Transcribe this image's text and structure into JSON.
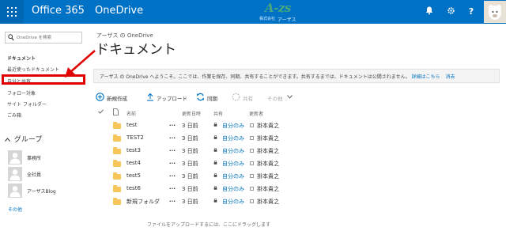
{
  "topbar": {
    "brand": "Office 365",
    "app_name": "OneDrive",
    "logo_text": "A-zs",
    "logo_sub": "アーザス",
    "logo_small": "株式会社",
    "icons": [
      "waffle-icon",
      "bell-icon",
      "gear-icon",
      "help-icon"
    ],
    "accent_color": "#0072c6"
  },
  "left_nav": {
    "search_placeholder": "OneDrive を検索",
    "heading": "ドキュメント",
    "items": [
      {
        "label": "最近使ったドキュメント"
      },
      {
        "label": "自分と共有"
      },
      {
        "label": "フォロー対象"
      },
      {
        "label": "サイト フォルダー"
      },
      {
        "label": "ごみ箱"
      }
    ],
    "groups_header": "グループ",
    "groups": [
      {
        "label": "事務所"
      },
      {
        "label": "全社員"
      },
      {
        "label": "アーザスBlog"
      }
    ],
    "more": "その他"
  },
  "main": {
    "breadcrumb": "アーザス の OneDrive",
    "title": "ドキュメント",
    "banner": {
      "message": "アーザス の OneDrive へようこそ。ここでは、作業を保存、同期、共有することができます。共有するまでは、ドキュメントは公開されません。",
      "link": "詳細はこちら",
      "dismiss": "消去"
    },
    "commands": {
      "new": "新規作成",
      "upload": "アップロード",
      "sync": "同期",
      "share": "共有",
      "more": "その他"
    },
    "columns": {
      "name": "名前",
      "modified": "更新日時",
      "shared": "共有",
      "modified_by": "更新者"
    },
    "files": [
      {
        "name": "test",
        "modified": "3 日前",
        "sharing": "自分のみ",
        "editor": "掛本貴之"
      },
      {
        "name": "TEST2",
        "modified": "3 日前",
        "sharing": "自分のみ",
        "editor": "掛本貴之"
      },
      {
        "name": "test3",
        "modified": "3 日前",
        "sharing": "自分のみ",
        "editor": "掛本貴之"
      },
      {
        "name": "test4",
        "modified": "3 日前",
        "sharing": "自分のみ",
        "editor": "掛本貴之"
      },
      {
        "name": "test5",
        "modified": "3 日前",
        "sharing": "自分のみ",
        "editor": "掛本貴之"
      },
      {
        "name": "test6",
        "modified": "3 日前",
        "sharing": "自分のみ",
        "editor": "掛本貴之"
      },
      {
        "name": "新規フォルダ",
        "modified": "3 日前",
        "sharing": "自分のみ",
        "editor": "掛本貴之"
      }
    ],
    "drop_hint": "ファイルをアップロードするには、ここにドラッグします",
    "row_menu": "..."
  }
}
